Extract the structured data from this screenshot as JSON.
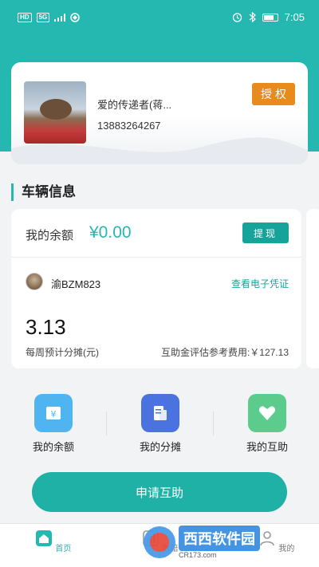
{
  "status_bar": {
    "left_chips": [
      "HD",
      "5G"
    ],
    "time": "7:05"
  },
  "profile": {
    "name": "爱的传递者(蒋...",
    "phone": "13883264267",
    "auth_label": "授权"
  },
  "section_title": "车辆信息",
  "vehicle_card": {
    "balance_label": "我的余额",
    "balance_value": "¥0.00",
    "withdraw_label": "提现",
    "plate": "渝BZM823",
    "voucher_link": "查看电子凭证",
    "weekly_value": "3.13",
    "weekly_label": "每周预计分摊(元)",
    "fee_label": "互助金评估参考费用:￥127.13"
  },
  "quick_actions": [
    {
      "label": "我的余额",
      "icon": "wallet-icon",
      "color": "#4fb4ef"
    },
    {
      "label": "我的分摊",
      "icon": "document-icon",
      "color": "#4a73e0"
    },
    {
      "label": "我的互助",
      "icon": "heart-icon",
      "color": "#5ccc8c"
    }
  ],
  "apply_button": "申请互助",
  "tabs": [
    {
      "label": "首页",
      "icon": "home-icon",
      "active": true
    },
    {
      "label": "数赔",
      "icon": "data-icon",
      "active": false
    },
    {
      "label": "我的",
      "icon": "profile-icon",
      "active": false
    }
  ],
  "watermark": {
    "brand": "西西软件园",
    "sub": "CR173.com"
  },
  "colors": {
    "brand_teal": "#25b8b0",
    "auth_orange": "#e88a1c",
    "withdraw_teal": "#16a39a"
  }
}
